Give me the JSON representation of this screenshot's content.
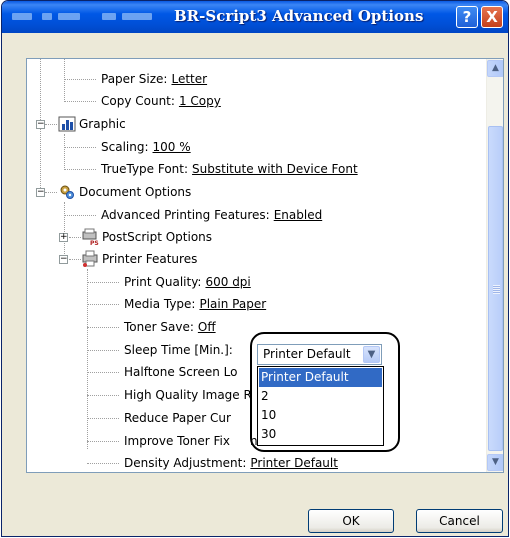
{
  "window": {
    "title": "BR-Script3 Advanced Options",
    "help_label": "?",
    "close_label": "X"
  },
  "tree": {
    "paper_size": {
      "label": "Paper Size:",
      "value": "Letter"
    },
    "copy_count": {
      "label": "Copy Count:",
      "value": "1 Copy"
    },
    "graphic": {
      "label": "Graphic"
    },
    "scaling": {
      "label": "Scaling:",
      "value": "100 %"
    },
    "truetype": {
      "label": "TrueType Font:",
      "value": "Substitute with Device Font"
    },
    "document_options": {
      "label": "Document Options"
    },
    "advanced_printing": {
      "label": "Advanced Printing Features:",
      "value": "Enabled"
    },
    "postscript": {
      "label": "PostScript Options"
    },
    "printer_features": {
      "label": "Printer Features"
    },
    "print_quality": {
      "label": "Print Quality:",
      "value": "600 dpi"
    },
    "media_type": {
      "label": "Media Type:",
      "value": "Plain Paper"
    },
    "toner_save": {
      "label": "Toner Save:",
      "value": "Off"
    },
    "sleep_time": {
      "label": "Sleep Time [Min.]:"
    },
    "halftone": {
      "label": "Halftone Screen Lo"
    },
    "high_quality": {
      "label": "High Quality Image R"
    },
    "reduce_paper": {
      "label": "Reduce Paper Cur"
    },
    "improve_toner": {
      "label": "Improve Toner Fix",
      "value": "n"
    },
    "density": {
      "label": "Density Adjustment:",
      "value": "Printer Default"
    }
  },
  "sleep_dropdown": {
    "selected": "Printer Default",
    "options": [
      "Printer Default",
      "2",
      "10",
      "30"
    ]
  },
  "buttons": {
    "ok": "OK",
    "cancel": "Cancel"
  },
  "colors": {
    "title_bar": "#0058e6",
    "selection": "#316ac5",
    "close_button": "#c3401c"
  }
}
